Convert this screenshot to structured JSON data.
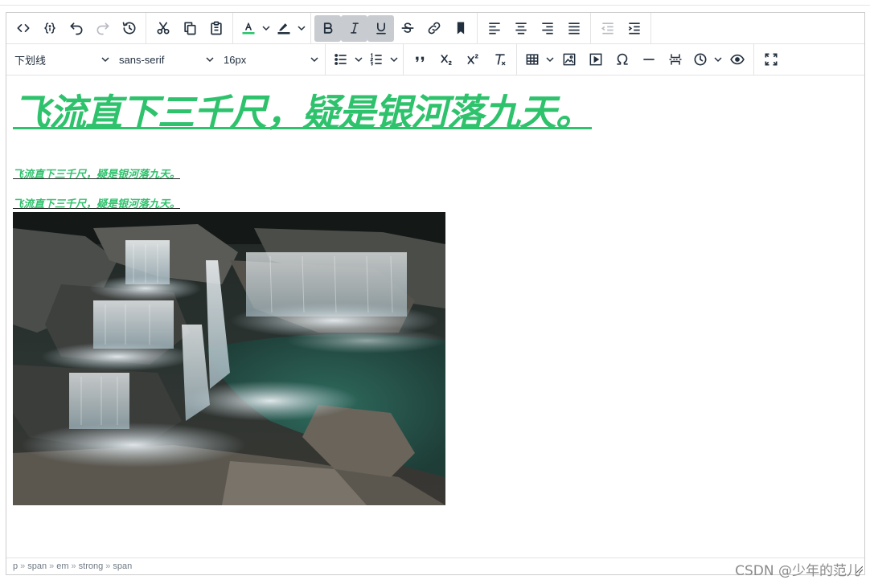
{
  "toolbar": {
    "row1": [
      {
        "name": "source-code-button",
        "icon": "code-icon"
      },
      {
        "name": "code-sample-button",
        "icon": "code-sample-icon"
      },
      {
        "name": "undo-button",
        "icon": "undo-icon"
      },
      {
        "name": "redo-button",
        "icon": "redo-icon",
        "disabled": true
      },
      {
        "name": "restore-draft-button",
        "icon": "history-icon"
      },
      {
        "name": "cut-button",
        "icon": "scissors-icon"
      },
      {
        "name": "copy-button",
        "icon": "copy-icon"
      },
      {
        "name": "paste-button",
        "icon": "clipboard-icon"
      },
      {
        "name": "text-color-button",
        "icon": "text-color-icon"
      },
      {
        "name": "highlight-color-button",
        "icon": "highlighter-icon"
      },
      {
        "name": "bold-button",
        "icon": "bold-icon",
        "active": true
      },
      {
        "name": "italic-button",
        "icon": "italic-icon",
        "active": true
      },
      {
        "name": "underline-button",
        "icon": "underline-icon",
        "active": true
      },
      {
        "name": "strikethrough-button",
        "icon": "strikethrough-icon"
      },
      {
        "name": "link-button",
        "icon": "link-icon"
      },
      {
        "name": "anchor-button",
        "icon": "bookmark-icon"
      },
      {
        "name": "align-left-button",
        "icon": "align-left-icon"
      },
      {
        "name": "align-center-button",
        "icon": "align-center-icon"
      },
      {
        "name": "align-right-button",
        "icon": "align-right-icon"
      },
      {
        "name": "justify-button",
        "icon": "justify-icon"
      },
      {
        "name": "outdent-button",
        "icon": "outdent-icon",
        "disabled": true
      },
      {
        "name": "indent-button",
        "icon": "indent-icon"
      }
    ],
    "block_format": "下划线",
    "font_family": "sans-serif",
    "font_size": "16px",
    "text_color": "#2dc26b",
    "highlight_color": "#222f3e"
  },
  "content": {
    "heading": "飞流直下三千尺，疑是银河落九天。",
    "line1": "飞流直下三千尺，疑是银河落九天。",
    "line2": "飞流直下三千尺，疑是银河落九天。",
    "accent_color": "#2dc26b"
  },
  "statusbar": {
    "path": [
      "p",
      "span",
      "em",
      "strong",
      "span"
    ],
    "separator": "»"
  },
  "watermark": "CSDN @少年的范儿"
}
